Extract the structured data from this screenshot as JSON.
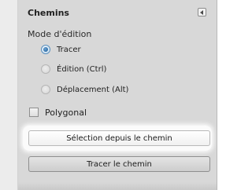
{
  "panel": {
    "title": "Chemins",
    "collapse_icon": "collapse-left-arrow-icon"
  },
  "mode": {
    "label": "Mode d'édition",
    "options": [
      {
        "label": "Tracer",
        "checked": true
      },
      {
        "label": "Édition (Ctrl)",
        "checked": false
      },
      {
        "label": "Déplacement (Alt)",
        "checked": false
      }
    ]
  },
  "polygonal": {
    "label": "Polygonal",
    "checked": false
  },
  "buttons": {
    "selection_label": "Sélection depuis le chemin",
    "stroke_label": "Tracer le chemin"
  },
  "colors": {
    "panel_bg": "#d8d8d8",
    "radio_selected": "#1f5e96"
  }
}
